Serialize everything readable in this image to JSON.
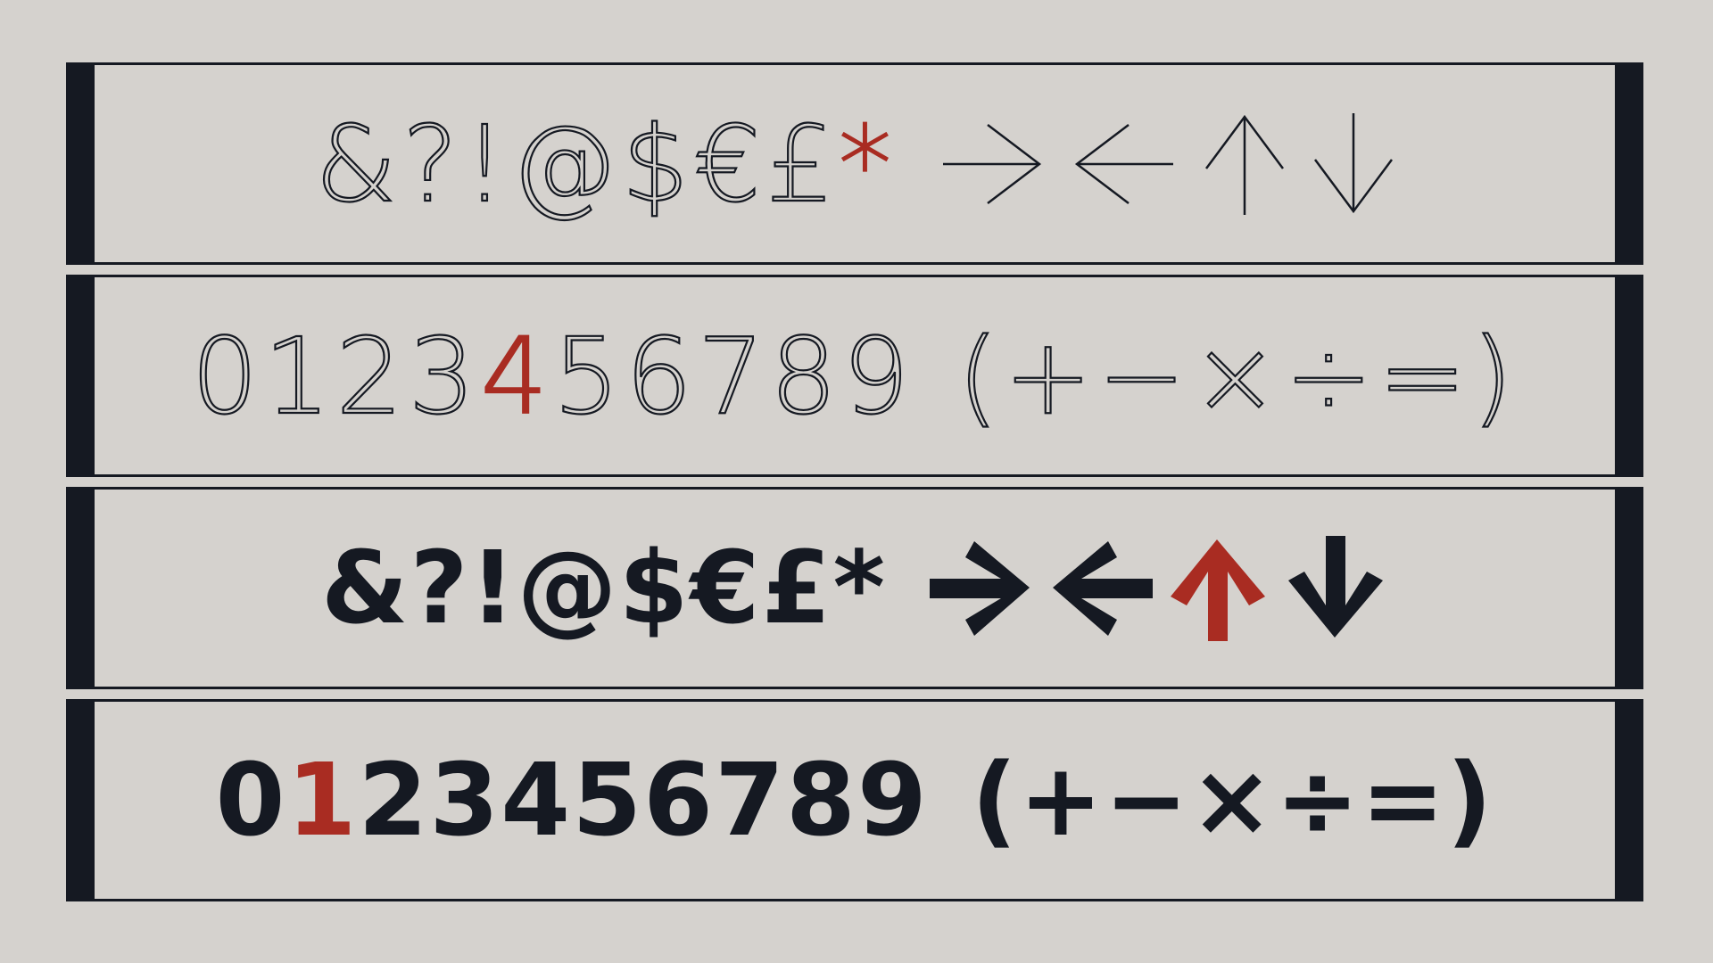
{
  "rows": [
    {
      "style": "light",
      "symbols_before": "&?!@$€£",
      "accent_symbol": "*",
      "arrows": [
        "→",
        "←",
        "↑",
        "↓"
      ],
      "accent_arrow_index": -1
    },
    {
      "style": "light",
      "digits_before": "0123",
      "accent_digit": "4",
      "digits_after": "56789",
      "math": "(+−×÷=)"
    },
    {
      "style": "bold",
      "symbols": "&?!@$€£*",
      "arrows": [
        "→",
        "←",
        "↑",
        "↓"
      ],
      "accent_arrow_index": 2
    },
    {
      "style": "bold",
      "digits_before": "0",
      "accent_digit": "1",
      "digits_after": "23456789",
      "math": "(+−×÷=)"
    }
  ],
  "colors": {
    "background": "#d5d2ce",
    "ink": "#151922",
    "accent": "#a92c22"
  }
}
